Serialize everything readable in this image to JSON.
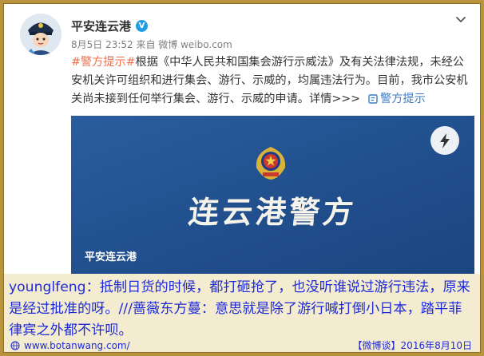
{
  "post": {
    "author": "平安连云港",
    "meta": "8月5日 23:52 来自 微博 weibo.com",
    "hashtag": "#警方提示#",
    "body": "根据《中华人民共和国集会游行示威法》及有关法律法规，未经公安机关许可组织和进行集会、游行、示威的，均属违法行为。目前，我市公安机关尚未接到任何举行集会、游行、示威的申请。",
    "more_link": "详情>>>",
    "topic_tag": "警方提示"
  },
  "video": {
    "title_text": "连云港警方",
    "caption": "平安连云港"
  },
  "comment": {
    "text": "younglfeng：抵制日货的时候，都打砸抢了，也没听谁说过游行违法，原来是经过批准的呀。///蔷薇东方蔓：意思就是除了游行喊打倒小日本，踏平菲律宾之外都不许呗。"
  },
  "footer": {
    "site": "www.botanwang.com/",
    "source": "【微博谈】2016年8月10日"
  },
  "colors": {
    "frame": "#b8953c",
    "hashtag": "#eb7350",
    "link": "#3b7cc4",
    "verified_badge": "#1f9de6",
    "video_bg": "#214f8d",
    "comment_bg": "#f4ecd0",
    "comment_text": "#1e2ad8"
  },
  "icons": {
    "avatar": "police-cartoon-avatar",
    "verified": "verified-v-badge",
    "menu": "chevron-down-icon",
    "topic": "topic-square-icon",
    "emblem": "police-emblem",
    "flash": "lightning-icon",
    "site": "globe-icon"
  }
}
